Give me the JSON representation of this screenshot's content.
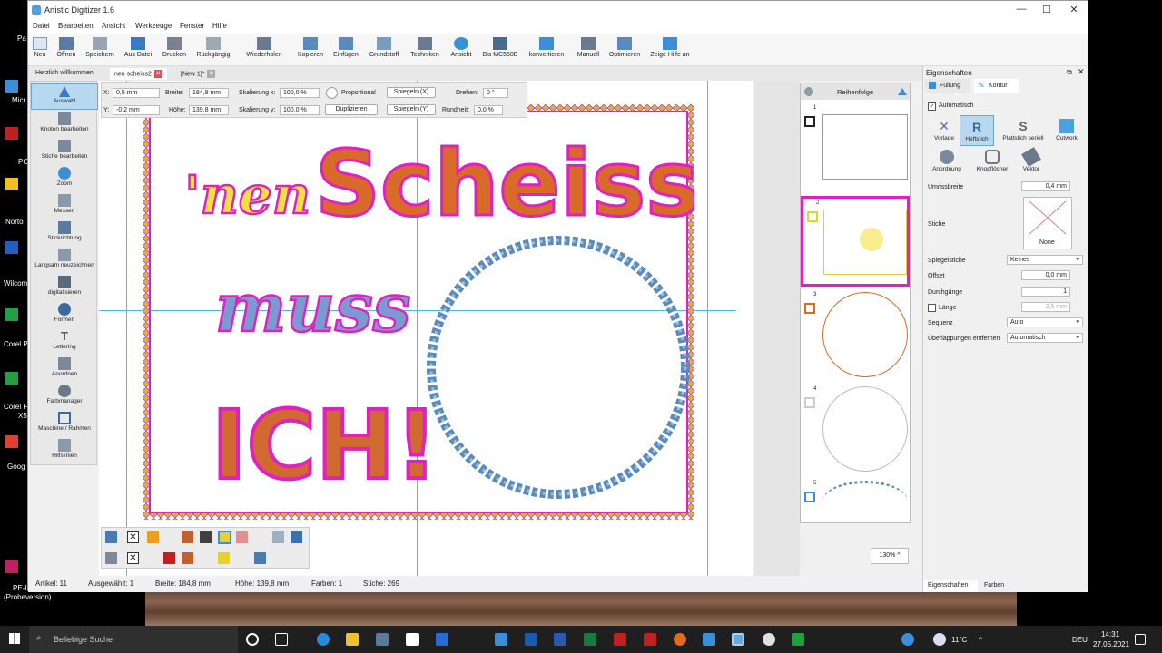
{
  "desktop": {
    "left_labels": [
      "Pa",
      "Micr",
      "PC",
      "Norto",
      "Wilcom",
      "Corel P",
      "Corel F",
      "X5",
      "Goog",
      "PE-I",
      "(Probeversion)"
    ]
  },
  "window": {
    "title": "Artistic Digitizer 1.6",
    "controls": [
      "—",
      "☐",
      "✕"
    ]
  },
  "menu": [
    "Datei",
    "Bearbeiten",
    "Ansicht",
    "Werkzeuge",
    "Fenster",
    "Hilfe"
  ],
  "toolbar": [
    "Neu",
    "Öffnen",
    "Speichern",
    "Aus Datei",
    "Drucken",
    "Rückgängig",
    "Wiederholen",
    "Kopieren",
    "Einfügen",
    "Grundstoff",
    "Techniken",
    "Ansicht",
    "Bis MC550E",
    "konvertieren",
    "Manuell",
    "Optimieren",
    "Zeige Hilfe an"
  ],
  "tabs": [
    {
      "label": "Herzlich willkommen",
      "close": "✕"
    },
    {
      "label": "nen scheiss2",
      "close": "✕"
    },
    {
      "label": "[New 1]*",
      "close": "✕"
    }
  ],
  "left_tools": [
    "Auswahl",
    "Knoten bearbeiten",
    "Stiche bearbeiten",
    "Zoom",
    "Messen",
    "Stickrichtung",
    "Langsam neuzeichnen",
    "digitalisieren",
    "Formen",
    "Lettering",
    "Anordnen",
    "Farbmanager",
    "Maschine / Rahmen",
    "Hilfslinien"
  ],
  "props": {
    "x_label": "X:",
    "x_value": "0,5 mm",
    "y_label": "Y:",
    "y_value": "-0,2 mm",
    "breite_label": "Breite:",
    "breite_value": "184,8 mm",
    "hoehe_label": "Höhe:",
    "hoehe_value": "139,8 mm",
    "skal_x_label": "Skalierung x:",
    "skal_x_value": "100,0 %",
    "skal_y_label": "Skalierung y:",
    "skal_y_value": "100,0 %",
    "proportional": "Proportional",
    "duplizieren": "Duplizieren",
    "spiegeln_x": "Spiegeln (X)",
    "spiegeln_y": "Spiegeln (Y)",
    "drehen_label": "Drehen:",
    "drehen_value": "0 °",
    "rundheit_label": "Rundheit:",
    "rundheit_value": "0,0 %"
  },
  "design": {
    "line1a": "'nen",
    "line1b": "Scheiss",
    "line2": "muss",
    "line3": "ICH!"
  },
  "status": {
    "artikel": "Artikel: 11",
    "ausgewaehlt": "Ausgewählt: 1",
    "breite": "Breite: 184,8 mm",
    "hoehe": "Höhe: 139,8 mm",
    "farben": "Farben: 1",
    "stiche": "Stiche: 269"
  },
  "sequence": {
    "title": "Reihenfolge",
    "items": [
      "1",
      "2",
      "3",
      "4",
      "5"
    ]
  },
  "zoom": "130%",
  "right": {
    "title": "Eigenschaften",
    "tab_fuellung": "Füllung",
    "tab_kontur": "Kontur",
    "automatisch": "Automatisch",
    "tools": [
      "Vorlage",
      "Heftstich",
      "Plattstich seriell",
      "Cutwork",
      "Anordnung",
      "Knopflöcher",
      "Vektor"
    ],
    "umrissbreite_label": "Umrissbreite",
    "umrissbreite_value": "0,4 mm",
    "stiche_label": "Stiche",
    "stiche_none": "None",
    "spiegelstiche_label": "Spiegelstiche",
    "spiegelstiche_value": "Keines",
    "offset_label": "Offset",
    "offset_value": "0,0 mm",
    "durchgaenge_label": "Durchgänge",
    "durchgaenge_value": "1",
    "laenge_label": "Länge",
    "laenge_value": "2,5 mm",
    "sequenz_label": "Sequenz",
    "sequenz_value": "Auto",
    "ueberlappungen_label": "Überlappungen entfernen",
    "ueberlappungen_value": "Automatisch",
    "bottom_tab1": "Eigenschaften",
    "bottom_tab2": "Farben"
  },
  "taskbar": {
    "search_placeholder": "Beliebige Suche",
    "weather": "11°C",
    "lang": "DEU",
    "time": "14:31",
    "date": "27.05.2021"
  },
  "colors": {
    "accent": "#3a8fd8",
    "magenta": "#e020c0",
    "orange": "#d86a2a",
    "blue_stitch": "#5a8ac0"
  }
}
